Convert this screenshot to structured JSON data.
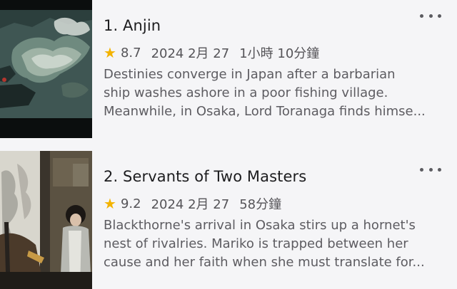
{
  "episodes": [
    {
      "title": "1. Anjin",
      "rating": "8.7",
      "date": "2024 2月 27",
      "duration": "1小時 10分鐘",
      "desc_lines": [
        "Destinies converge in Japan after a barbarian",
        "ship washes ashore in a poor fishing village.",
        "Meanwhile, in Osaka, Lord Toranaga finds himse..."
      ]
    },
    {
      "title": "2. Servants of Two Masters",
      "rating": "9.2",
      "date": "2024 2月 27",
      "duration": "58分鐘",
      "desc_lines": [
        "Blackthorne's arrival in Osaka stirs up a hornet's",
        "nest of rivalries. Mariko is trapped between her",
        "cause and her faith when she must translate for..."
      ]
    }
  ],
  "icons": {
    "rating": "star-icon",
    "more": "more-horizontal-icon"
  },
  "colors": {
    "star": "#f3b300",
    "background": "#f5f5f7"
  }
}
